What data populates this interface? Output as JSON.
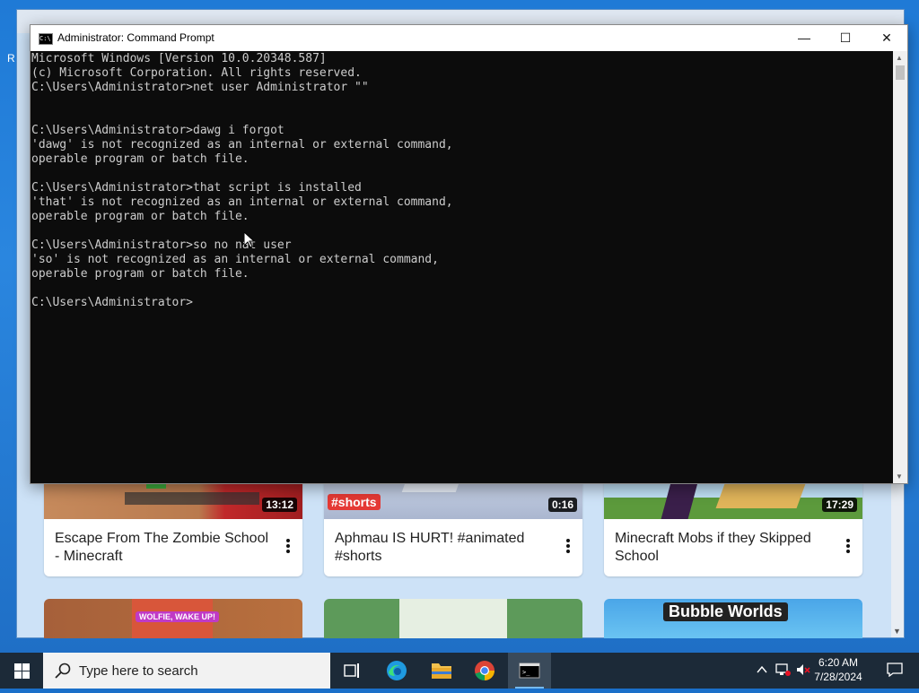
{
  "desktop": {
    "side_marks": [
      "R"
    ]
  },
  "browser": {
    "row1": [
      {
        "title": "Escape From The Zombie School - Minecraft",
        "duration": "13:12"
      },
      {
        "title": "Aphmau IS HURT! #animated #shorts",
        "duration": "0:16",
        "badge": "#shorts"
      },
      {
        "title": "Minecraft Mobs if they Skipped School",
        "duration": "17:29"
      }
    ],
    "row2": {
      "wolfie_text": "WOLFIE, WAKE UP!",
      "bubble_text": "Bubble Worlds"
    }
  },
  "cmd": {
    "title": "Administrator: Command Prompt",
    "minimize": "—",
    "maximize": "☐",
    "close": "✕",
    "lines": [
      "Microsoft Windows [Version 10.0.20348.587]",
      "(c) Microsoft Corporation. All rights reserved.",
      "C:\\Users\\Administrator>net user Administrator \"\"",
      "",
      "",
      "C:\\Users\\Administrator>dawg i forgot",
      "'dawg' is not recognized as an internal or external command,",
      "operable program or batch file.",
      "",
      "C:\\Users\\Administrator>that script is installed",
      "'that' is not recognized as an internal or external command,",
      "operable program or batch file.",
      "",
      "C:\\Users\\Administrator>so no nat user",
      "'so' is not recognized as an internal or external command,",
      "operable program or batch file.",
      "",
      "C:\\Users\\Administrator>"
    ]
  },
  "taskbar": {
    "search_placeholder": "Type here to search",
    "time": "6:20 AM",
    "date": "7/28/2024",
    "apps": [
      "task-view",
      "edge",
      "file-explorer",
      "chrome",
      "command-prompt"
    ],
    "active_app": "command-prompt"
  }
}
